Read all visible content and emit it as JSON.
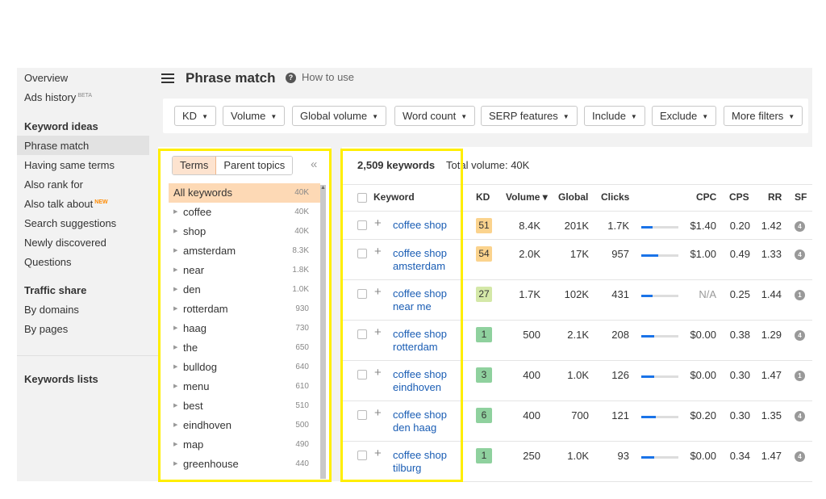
{
  "sidebar": {
    "items": [
      {
        "label": "Overview"
      },
      {
        "label": "Ads history",
        "badge": "BETA"
      }
    ],
    "keyword_ideas": {
      "heading": "Keyword ideas",
      "items": [
        {
          "label": "Phrase match",
          "active": true
        },
        {
          "label": "Having same terms"
        },
        {
          "label": "Also rank for"
        },
        {
          "label": "Also talk about",
          "badge": "NEW"
        },
        {
          "label": "Search suggestions"
        },
        {
          "label": "Newly discovered"
        },
        {
          "label": "Questions"
        }
      ]
    },
    "traffic_share": {
      "heading": "Traffic share",
      "items": [
        {
          "label": "By domains"
        },
        {
          "label": "By pages"
        }
      ]
    },
    "keywords_lists": "Keywords lists"
  },
  "header": {
    "title": "Phrase match",
    "how_to_use": "How to use",
    "help_glyph": "?"
  },
  "filters": [
    {
      "label": "KD"
    },
    {
      "label": "Volume"
    },
    {
      "label": "Global volume"
    },
    {
      "label": "Word count"
    },
    {
      "label": "SERP features"
    },
    {
      "label": "Include"
    },
    {
      "label": "Exclude"
    },
    {
      "label": "More filters"
    }
  ],
  "terms_panel": {
    "tabs": [
      "Terms",
      "Parent topics"
    ],
    "collapse_glyph": "«",
    "rows": [
      {
        "label": "All keywords",
        "count": "40K",
        "active": true
      },
      {
        "label": "coffee",
        "count": "40K"
      },
      {
        "label": "shop",
        "count": "40K"
      },
      {
        "label": "amsterdam",
        "count": "8.3K"
      },
      {
        "label": "near",
        "count": "1.8K"
      },
      {
        "label": "den",
        "count": "1.0K"
      },
      {
        "label": "rotterdam",
        "count": "930"
      },
      {
        "label": "haag",
        "count": "730"
      },
      {
        "label": "the",
        "count": "650"
      },
      {
        "label": "bulldog",
        "count": "640"
      },
      {
        "label": "menu",
        "count": "610"
      },
      {
        "label": "best",
        "count": "510"
      },
      {
        "label": "eindhoven",
        "count": "500"
      },
      {
        "label": "map",
        "count": "490"
      },
      {
        "label": "greenhouse",
        "count": "440"
      }
    ]
  },
  "keywords_panel": {
    "count": "2,509 keywords",
    "total_volume": "Total volume: 40K",
    "columns": {
      "keyword": "Keyword",
      "kd": "KD",
      "volume": "Volume ▾",
      "global": "Global",
      "clicks": "Clicks",
      "cpc": "CPC",
      "cps": "CPS",
      "rr": "RR",
      "sf": "SF"
    },
    "rows": [
      {
        "kw1": "coffee shop",
        "kw2": "",
        "kd": "51",
        "kd_color": "#fbd38d",
        "volume": "8.4K",
        "global": "201K",
        "clicks": "1.7K",
        "clicks_bar": 0.3,
        "cpc": "$1.40",
        "cps": "0.20",
        "rr": "1.42",
        "sf": "4"
      },
      {
        "kw1": "coffee shop",
        "kw2": "amsterdam",
        "kd": "54",
        "kd_color": "#fbd38d",
        "volume": "2.0K",
        "global": "17K",
        "clicks": "957",
        "clicks_bar": 0.45,
        "cpc": "$1.00",
        "cps": "0.49",
        "rr": "1.33",
        "sf": "4"
      },
      {
        "kw1": "coffee shop",
        "kw2": "near me",
        "kd": "27",
        "kd_color": "#d4e8a8",
        "volume": "1.7K",
        "global": "102K",
        "clicks": "431",
        "clicks_bar": 0.3,
        "cpc": "N/A",
        "cps": "0.25",
        "rr": "1.44",
        "sf": "1"
      },
      {
        "kw1": "coffee shop",
        "kw2": "rotterdam",
        "kd": "1",
        "kd_color": "#8fd19e",
        "volume": "500",
        "global": "2.1K",
        "clicks": "208",
        "clicks_bar": 0.35,
        "cpc": "$0.00",
        "cps": "0.38",
        "rr": "1.29",
        "sf": "4"
      },
      {
        "kw1": "coffee shop",
        "kw2": "eindhoven",
        "kd": "3",
        "kd_color": "#8fd19e",
        "volume": "400",
        "global": "1.0K",
        "clicks": "126",
        "clicks_bar": 0.35,
        "cpc": "$0.00",
        "cps": "0.30",
        "rr": "1.47",
        "sf": "1"
      },
      {
        "kw1": "coffee shop",
        "kw2": "den haag",
        "kd": "6",
        "kd_color": "#8fd19e",
        "volume": "400",
        "global": "700",
        "clicks": "121",
        "clicks_bar": 0.4,
        "cpc": "$0.20",
        "cps": "0.30",
        "rr": "1.35",
        "sf": "4"
      },
      {
        "kw1": "coffee shop",
        "kw2": "tilburg",
        "kd": "1",
        "kd_color": "#8fd19e",
        "volume": "250",
        "global": "1.0K",
        "clicks": "93",
        "clicks_bar": 0.35,
        "cpc": "$0.00",
        "cps": "0.34",
        "rr": "1.47",
        "sf": "4"
      }
    ]
  },
  "colors": {
    "highlight": "#ffee00",
    "link": "#1a5db4",
    "bar": "#1a73e8"
  }
}
